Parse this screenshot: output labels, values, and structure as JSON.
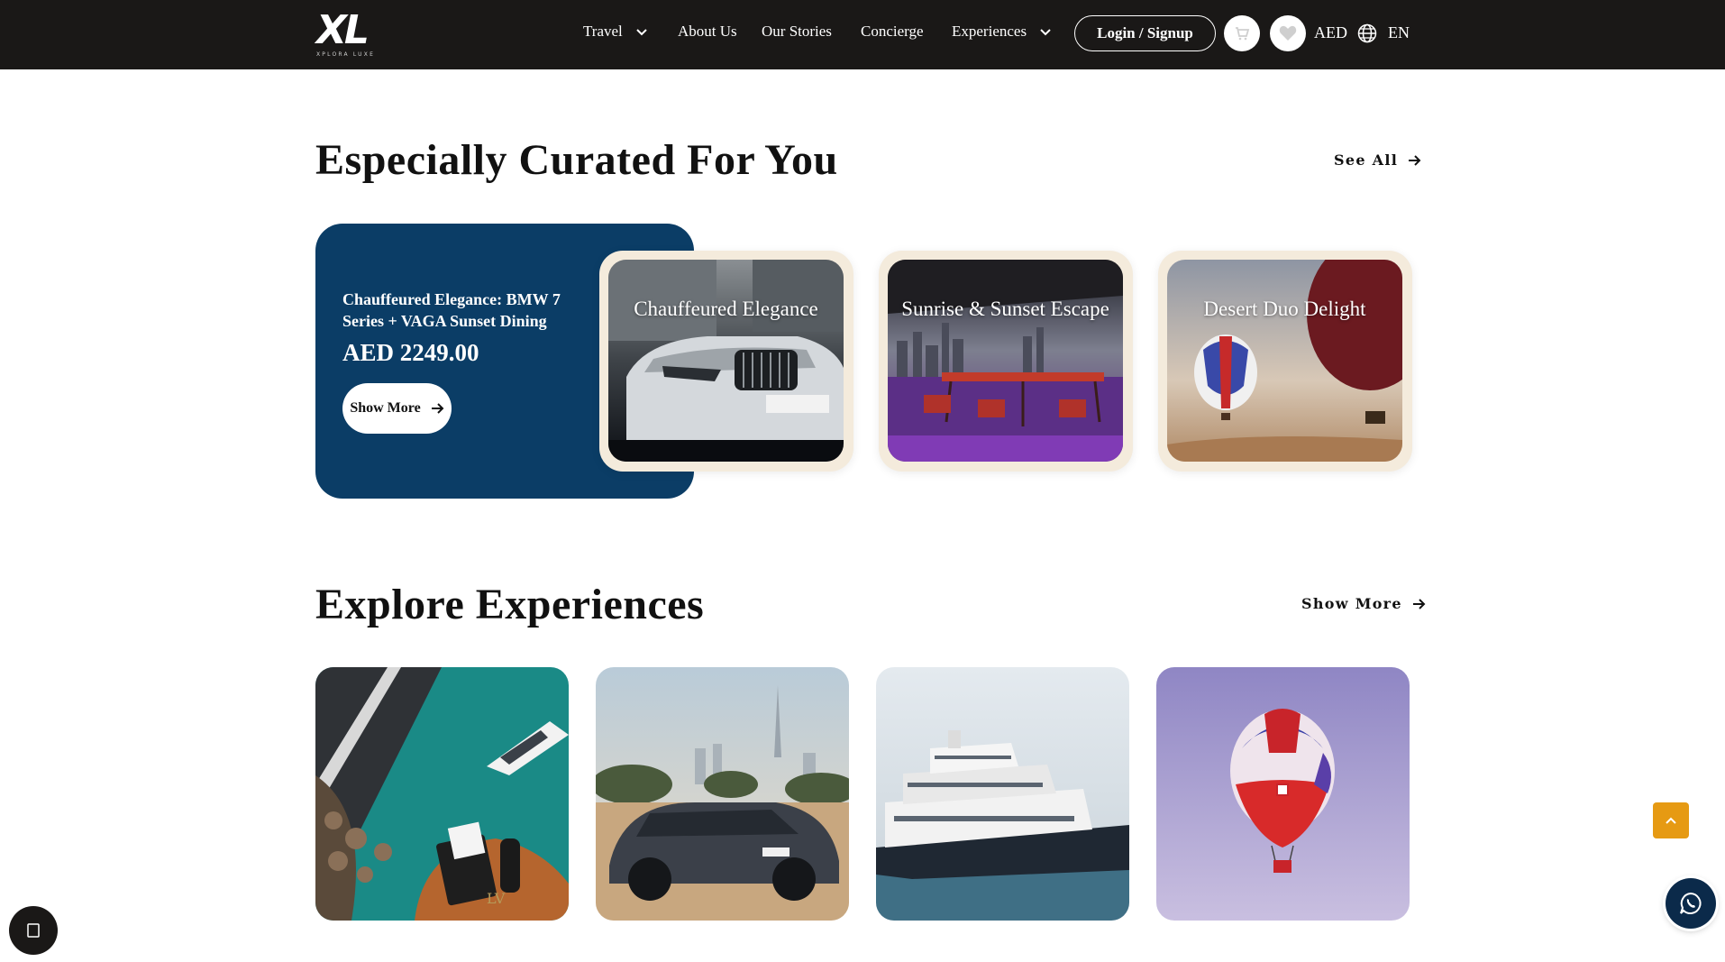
{
  "header": {
    "logo_text": "XL",
    "logo_subtext": "XPLORA LUXE",
    "nav": [
      {
        "label": "Travel",
        "has_dropdown": true
      },
      {
        "label": "About Us",
        "has_dropdown": false
      },
      {
        "label": "Our Stories",
        "has_dropdown": false
      },
      {
        "label": "Concierge",
        "has_dropdown": false
      },
      {
        "label": "Experiences",
        "has_dropdown": true
      }
    ],
    "login_label": "Login / Signup",
    "cart_icon": "cart-icon",
    "wishlist_icon": "heart-icon",
    "currency": "AED",
    "language": "EN"
  },
  "curated": {
    "title": "Especially Curated For You",
    "see_all_label": "See All",
    "featured": {
      "title": "Chauffeured Elegance: BMW 7 Series + VAGA Sunset Dining",
      "price": "AED 2249.00",
      "button_label": "Show More"
    },
    "cards": [
      {
        "label": "Chauffeured Elegance"
      },
      {
        "label": "Sunrise & Sunset Escape"
      },
      {
        "label": "Desert Duo Delight"
      }
    ]
  },
  "explore": {
    "title": "Explore Experiences",
    "show_more_label": "Show More"
  },
  "colors": {
    "header_bg": "#1a1817",
    "feature_bg": "#0b3d66",
    "card_frame": "#f4ebdc",
    "scroll_top_bg": "#e69a13",
    "whatsapp_bg": "#0b2a4a"
  }
}
